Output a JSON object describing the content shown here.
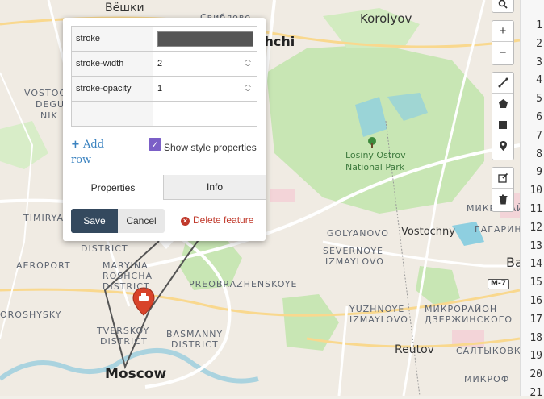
{
  "map": {
    "labels": {
      "vyoshki": "Вёшки",
      "sviblovo_partial": "Свиблово",
      "shchi": "shchi",
      "korolyov": "Korolyov",
      "vostoc": "VOSTOC",
      "degu": "DEGU",
      "nik": "NIK",
      "timirya": "TIMIRYA",
      "aeroport": "AEROPORT",
      "district_top": "DISTRICT",
      "marina_1": "MARYINA",
      "marina_2": "ROSHCHA",
      "marina_3": "DISTRICT",
      "preobrazhenskoye": "PREOBRAZHENSKOYE",
      "roshysky": "OROSHYSKY",
      "tverskoy_1": "TVERSKOY",
      "tverskoy_2": "DISTRICT",
      "basmanny_1": "BASMANNY",
      "basmanny_2": "DISTRICT",
      "moscow": "Moscow",
      "losiny_1": "Losiny Ostrov",
      "losiny_2": "National Park",
      "golyanovo": "GOLYANOVO",
      "vostochny": "Vostochny",
      "severnoye_1": "SEVERNOYE",
      "severnoye_2": "IZMAYLOVO",
      "yuzhnoye_1": "YUZHNOYE",
      "yuzhnoye_2": "IZMAYLOVO",
      "mikro1_1": "МИКРОРАЙОН",
      "mikro1_2": "ГАГАРИН",
      "mikro2_1": "МИКРОРАЙОН",
      "mikro2_2": "ДЗЕРЖИНСКОГО",
      "reutov": "Reutov",
      "saltykovka": "САЛТЫКОВКА",
      "ba": "Ba",
      "m7": "M-7",
      "mikrof": "МИКРОФ"
    }
  },
  "toolbar": {
    "search_icon": "search-icon",
    "zoom_in": "+",
    "zoom_out": "−",
    "draw_line_icon": "line-icon",
    "draw_polygon_icon": "polygon-icon",
    "draw_rectangle_icon": "rectangle-icon",
    "draw_marker_icon": "marker-icon",
    "edit_icon": "edit-icon",
    "delete_icon": "trash-icon"
  },
  "editor": {
    "line_numbers": [
      "1",
      "2",
      "3",
      "4",
      "5",
      "6",
      "7",
      "8",
      "9",
      "10",
      "11",
      "12",
      "13",
      "14",
      "15",
      "16",
      "17",
      "18",
      "19",
      "20",
      "21"
    ]
  },
  "popup": {
    "rows": [
      {
        "key": "stroke",
        "value": "",
        "color": "#555555"
      },
      {
        "key": "stroke-width",
        "value": "2"
      },
      {
        "key": "stroke-opacity",
        "value": "1"
      },
      {
        "key": "",
        "value": ""
      }
    ],
    "add_row_label": "Add row",
    "show_style_label": "Show style properties",
    "show_style_checked": true,
    "tabs": [
      {
        "label": "Properties",
        "active": true
      },
      {
        "label": "Info",
        "active": false
      }
    ],
    "save_label": "Save",
    "cancel_label": "Cancel",
    "delete_label": "Delete feature"
  },
  "colors": {
    "accent": "#34495e",
    "marker": "#d8432a",
    "danger": "#c0392b",
    "checkbox": "#7b5fc7",
    "link": "#3b83c0"
  }
}
